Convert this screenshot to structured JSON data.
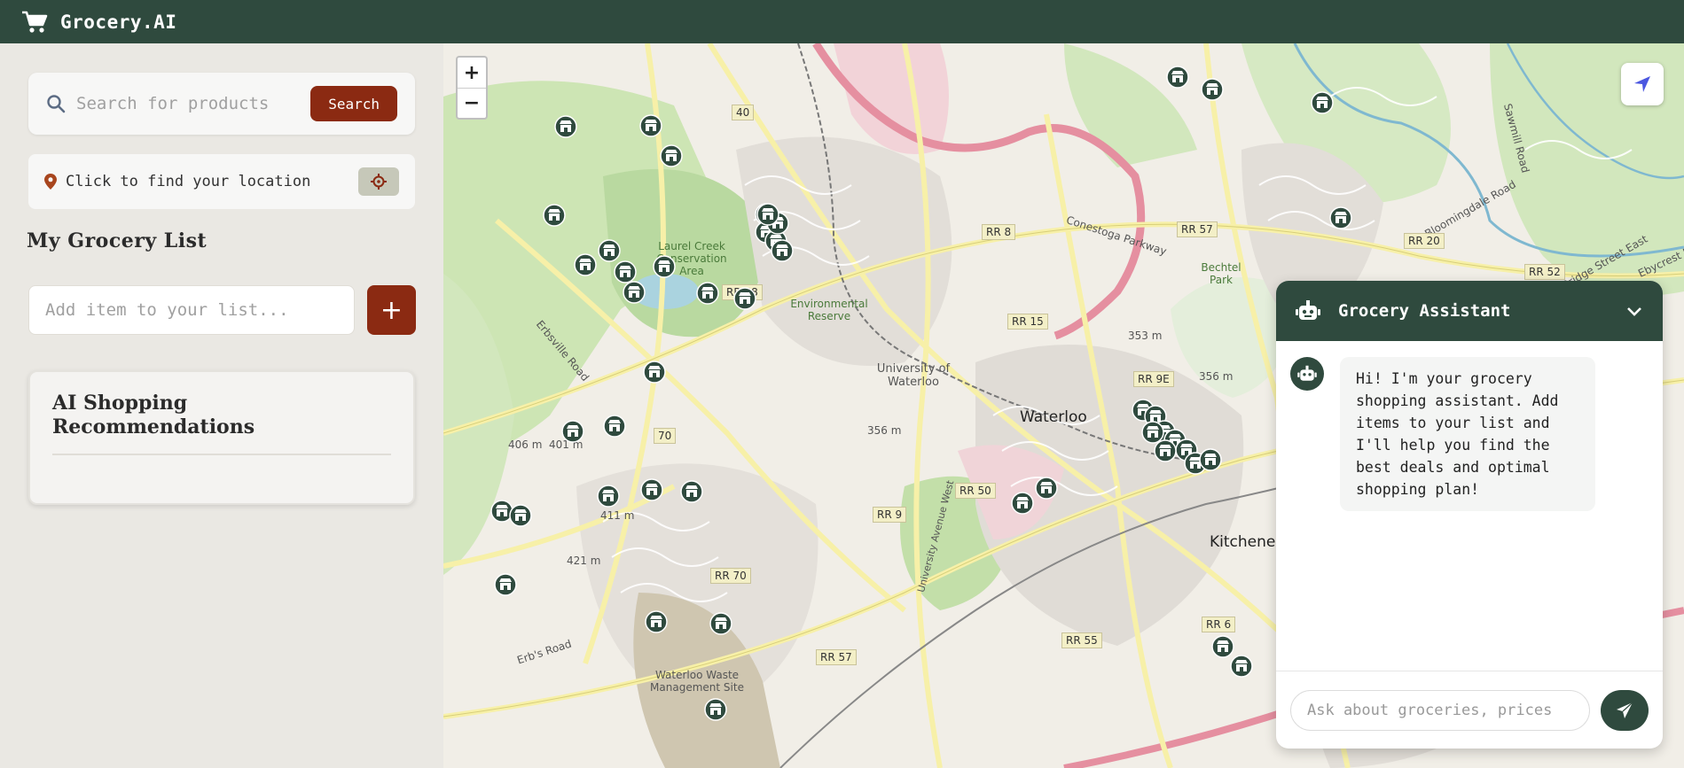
{
  "header": {
    "app_title": "Grocery.AI"
  },
  "sidebar": {
    "search": {
      "placeholder": "Search for products",
      "button_label": "Search"
    },
    "location": {
      "label": "Click to find your location"
    },
    "list_title": "My Grocery List",
    "add_item": {
      "placeholder": "Add item to your list...",
      "button_label": "+"
    },
    "recommendations": {
      "title": "AI Shopping Recommendations"
    }
  },
  "map": {
    "zoom_in": "+",
    "zoom_out": "−",
    "labels": {
      "city_waterloo": "Waterloo",
      "city_kitchener": "Kitchener",
      "uw": "University of Waterloo",
      "laurel": "Laurel Creek Conservation Area",
      "env_reserve": "Environmental Reserve",
      "bechtel": "Bechtel Park",
      "waste": "Waterloo Waste Management Site",
      "conestoga": "Conestoga Parkway",
      "erbsville": "Erbsville Road",
      "erbs": "Erb's Road",
      "univ_ave": "University Avenue West",
      "bloomingdale": "Bloomingdale Road",
      "bridge": "Bridge Street East",
      "sawmill": "Sawmill Road",
      "ebycrest": "Ebycrest R",
      "r40": "40",
      "r70": "70",
      "rr8": "RR 8",
      "rr57a": "RR 57",
      "rr57b": "RR 57",
      "rr20": "RR 20",
      "rr52": "RR 52",
      "rr58": "RR 58",
      "rr15": "RR 15",
      "rr9e": "RR 9E",
      "rr50": "RR 50",
      "rr9": "RR 9",
      "rr70": "RR 70",
      "rr6": "RR 6",
      "rr55": "RR 55",
      "e353": "353 m",
      "e356a": "356 m",
      "e356b": "356 m",
      "e406": "406 m",
      "e401": "401 m",
      "e411": "411 m",
      "e421": "421 m"
    }
  },
  "chat": {
    "title": "Grocery Assistant",
    "messages": [
      {
        "from": "assistant",
        "text": "Hi! I'm your grocery shopping assistant. Add items to your list and I'll help you find the best deals and optimal shopping plan!"
      }
    ],
    "input_placeholder": "Ask about groceries, prices"
  },
  "colors": {
    "primary": "#2f4a3e",
    "accent": "#8b2a12",
    "background": "#eae8e3"
  },
  "icons": [
    "cart-icon",
    "search-icon",
    "map-pin-icon",
    "crosshair-icon",
    "locate-arrow-icon",
    "store-icon",
    "robot-icon",
    "chevron-down-icon",
    "send-icon"
  ]
}
